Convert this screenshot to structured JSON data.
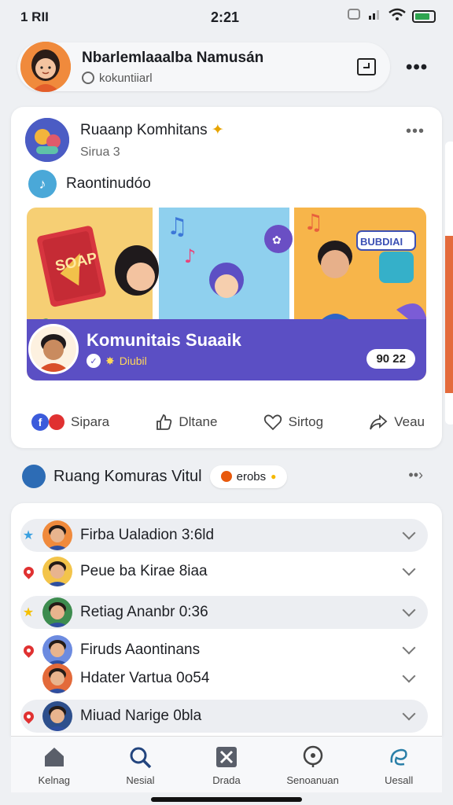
{
  "status_bar": {
    "left": "1 RII",
    "time": "2:21",
    "battery_fill": 0.8
  },
  "profile": {
    "name": "Nbarlemlaaalba Namusán",
    "handle": "kokuntiiarl"
  },
  "post": {
    "group_name": "Ruaanp Komhitans",
    "group_sub": "Sirua 3",
    "caption": "Raontinudóo",
    "hero": {
      "book_label": "SOAP",
      "sign_label": "BUBDIAI",
      "title": "Komunitais Suaaik",
      "sub": "Diubil",
      "badge": "90 22"
    },
    "actions": [
      {
        "label": "Sipara",
        "icon": "facebook-icon"
      },
      {
        "label": "Dltane",
        "icon": "thumb-icon"
      },
      {
        "label": "Sirtog",
        "icon": "heart-icon"
      },
      {
        "label": "Veau",
        "icon": "share-icon"
      }
    ]
  },
  "room": {
    "title": "Ruang Komuras Vitul",
    "chip": "erobs"
  },
  "list": [
    {
      "label": "Firba Ualadion 3:6ld",
      "marker": "star-blue",
      "highlight": true
    },
    {
      "label": "Peue ba Kirae 8iaa",
      "marker": "pin",
      "highlight": false
    },
    {
      "label": "Retiag Ananbr 0:36",
      "marker": "star-yellow",
      "highlight": true
    },
    {
      "label": "Firuds Aaontinans",
      "marker": "pin",
      "highlight": false
    },
    {
      "label": "Hdater Vartua 0o54",
      "marker": "none",
      "highlight": false
    },
    {
      "label": "Miuad Narige 0bla",
      "marker": "pin",
      "highlight": true
    }
  ],
  "nav": [
    {
      "label": "Kelnag",
      "icon": "home-icon"
    },
    {
      "label": "Nesial",
      "icon": "search-icon"
    },
    {
      "label": "Drada",
      "icon": "close-box-icon"
    },
    {
      "label": "Senoanuan",
      "icon": "location-icon"
    },
    {
      "label": "Uesall",
      "icon": "swirl-icon"
    }
  ]
}
